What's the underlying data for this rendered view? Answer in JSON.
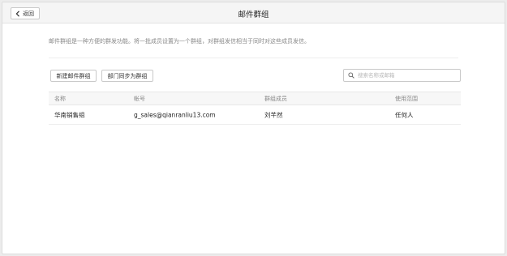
{
  "header": {
    "back_label": "返回",
    "title": "邮件群组"
  },
  "description": "邮件群组是一种方便的群发功能。将一批成员设置为一个群组，对群组发信相当于同时对这些成员发信。",
  "toolbar": {
    "new_group_label": "新建邮件群组",
    "sync_dept_label": "部门同步为群组"
  },
  "search": {
    "placeholder": "搜索名称或邮箱",
    "value": ""
  },
  "table": {
    "columns": [
      "名称",
      "帐号",
      "群组成员",
      "使用范围"
    ],
    "rows": [
      {
        "name": "华南销售组",
        "account": "g_sales@qianranliu13.com",
        "members": "刘芊然",
        "scope": "任何人"
      }
    ]
  },
  "icons": {
    "back": "chevron-left-icon",
    "search": "search-icon"
  }
}
